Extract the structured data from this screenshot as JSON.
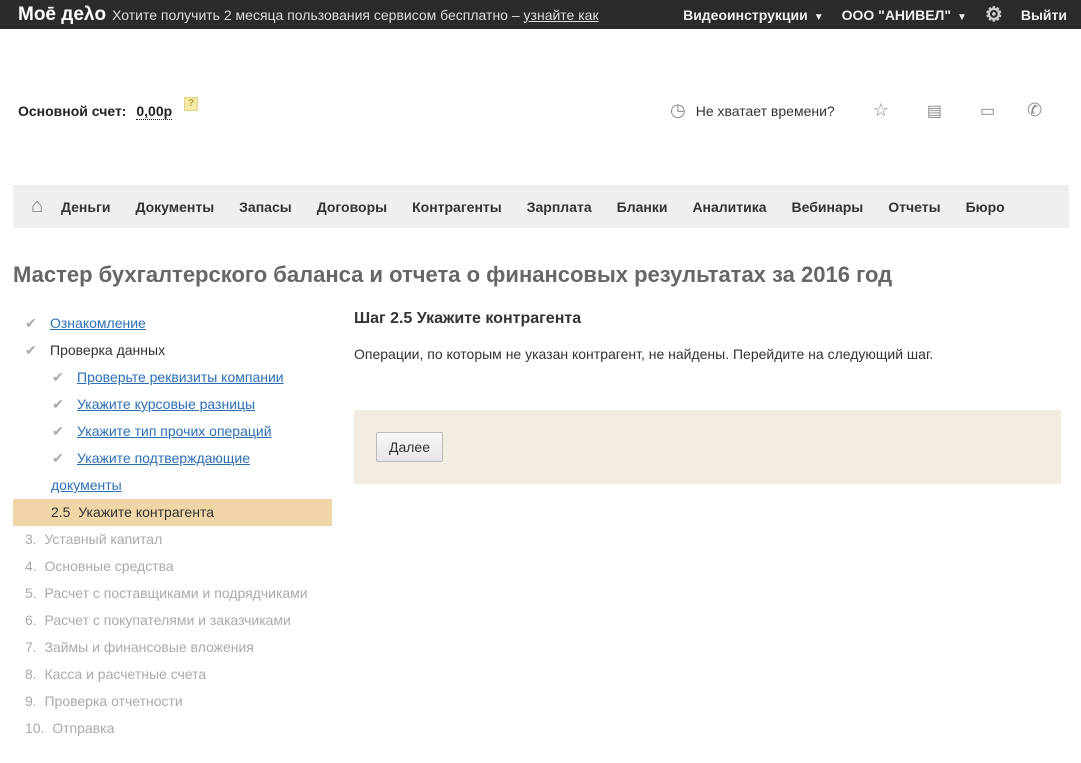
{
  "topbar": {
    "logo": "Moē деλо",
    "promo": "Хотите получить 2 месяца пользования сервисом бесплатно –",
    "promo_link": "узнайте как",
    "video": "Видеоинструкции",
    "company": "ООО \"АНИВЕЛ\"",
    "logout": "Выйти"
  },
  "account": {
    "label": "Основной счет:",
    "value": "0,00р",
    "help": "?"
  },
  "tools": {
    "time": "Не хватает времени?"
  },
  "nav": [
    "Деньги",
    "Документы",
    "Запасы",
    "Договоры",
    "Контрагенты",
    "Зарплата",
    "Бланки",
    "Аналитика",
    "Вебинары",
    "Отчеты",
    "Бюро"
  ],
  "title": "Мастер бухгалтерского баланса и отчета о финансовых результатах за 2016 год",
  "steps": {
    "intro": "Ознакомление",
    "check": "Проверка данных",
    "sub": [
      "Проверьте реквизиты компании",
      "Укажите курсовые разницы",
      "Укажите тип прочих операций",
      "Укажите подтверждающие",
      "документы"
    ],
    "active_num": "2.5",
    "active": "Укажите контрагента",
    "rest": [
      {
        "n": "3.",
        "t": "Уставный капитал"
      },
      {
        "n": "4.",
        "t": "Основные средства"
      },
      {
        "n": "5.",
        "t": "Расчет с поставщиками и подрядчиками"
      },
      {
        "n": "6.",
        "t": "Расчет с покупателями и заказчиками"
      },
      {
        "n": "7.",
        "t": "Займы и финансовые вложения"
      },
      {
        "n": "8.",
        "t": "Касса и расчетные счета"
      },
      {
        "n": "9.",
        "t": "Проверка отчетности"
      },
      {
        "n": "10.",
        "t": "Отправка"
      }
    ]
  },
  "main": {
    "heading": "Шаг 2.5 Укажите контрагента",
    "text": "Операции, по которым не указан контрагент, не найдены. Перейдите на следующий шаг.",
    "next": "Далее"
  }
}
